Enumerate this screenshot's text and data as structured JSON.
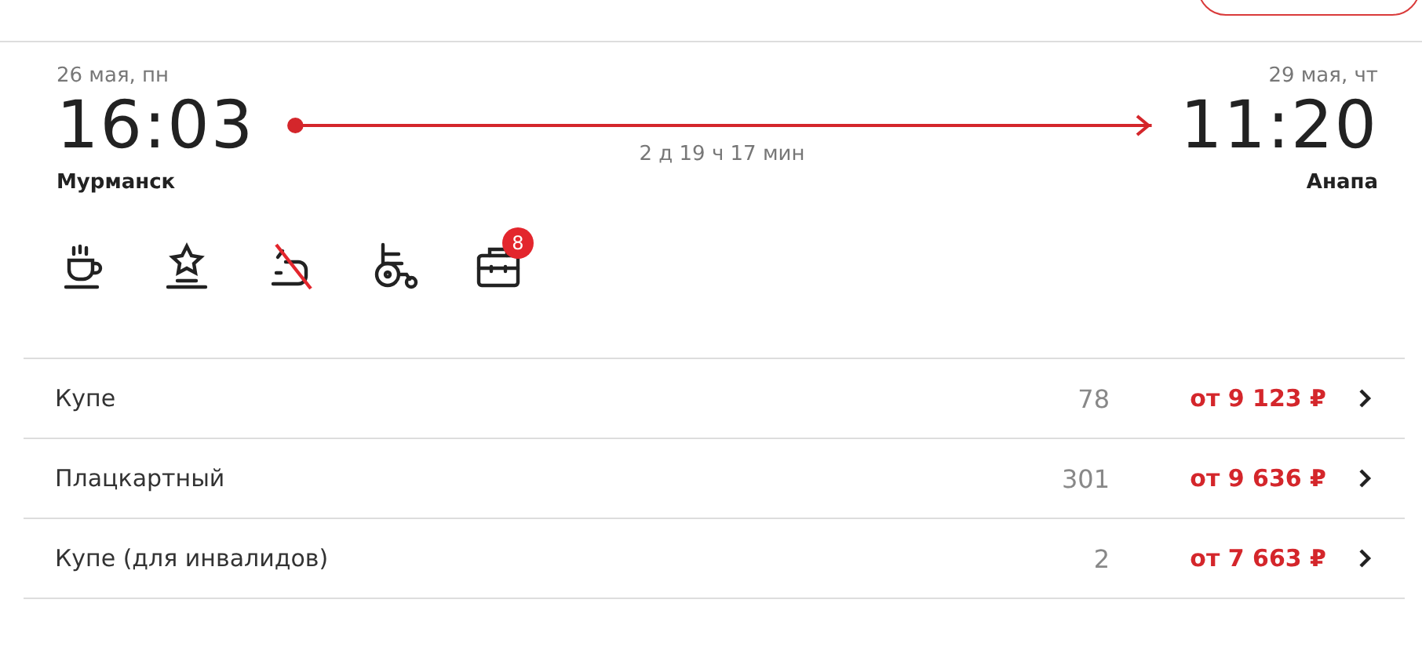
{
  "departure": {
    "date": "26 мая, пн",
    "time": "16:03",
    "station": "Мурманск"
  },
  "arrival": {
    "date": "29 мая, чт",
    "time": "11:20",
    "station": "Анапа"
  },
  "duration": "2 д 19 ч 17 мин",
  "amenities": [
    {
      "kind": "cup",
      "available": true
    },
    {
      "kind": "star",
      "available": true
    },
    {
      "kind": "outlet",
      "available": false
    },
    {
      "kind": "wheelchair",
      "available": true
    },
    {
      "kind": "briefcase",
      "available": true,
      "badge": "8"
    }
  ],
  "classes": [
    {
      "name": "Купе",
      "seats": "78",
      "price": "от 9 123 ₽"
    },
    {
      "name": "Плацкартный",
      "seats": "301",
      "price": "от 9 636 ₽"
    },
    {
      "name": "Купе (для инвалидов)",
      "seats": "2",
      "price": "от 7 663 ₽"
    }
  ]
}
